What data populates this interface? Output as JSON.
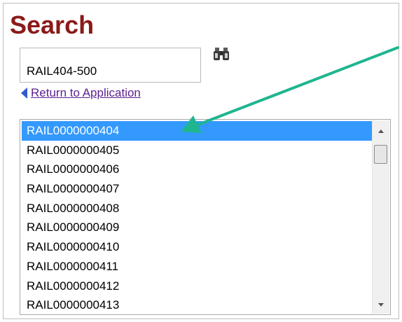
{
  "header": {
    "title": "Search"
  },
  "search": {
    "value": "RAIL404-500",
    "button_icon": "binoculars-icon"
  },
  "nav": {
    "return_label": "Return to Application",
    "return_icon": "left-triangle-icon"
  },
  "results": {
    "items": [
      "RAIL0000000404",
      "RAIL0000000405",
      "RAIL0000000406",
      "RAIL0000000407",
      "RAIL0000000408",
      "RAIL0000000409",
      "RAIL0000000410",
      "RAIL0000000411",
      "RAIL0000000412",
      "RAIL0000000413"
    ],
    "selected_index": 0
  },
  "annotation": {
    "type": "arrow",
    "color": "#1fb58f",
    "points_to": "RAIL0000000404"
  },
  "colors": {
    "title": "#8b1a1a",
    "selection": "#3399ff",
    "link": "#5b1f8f",
    "link_icon": "#2f5bd0"
  }
}
